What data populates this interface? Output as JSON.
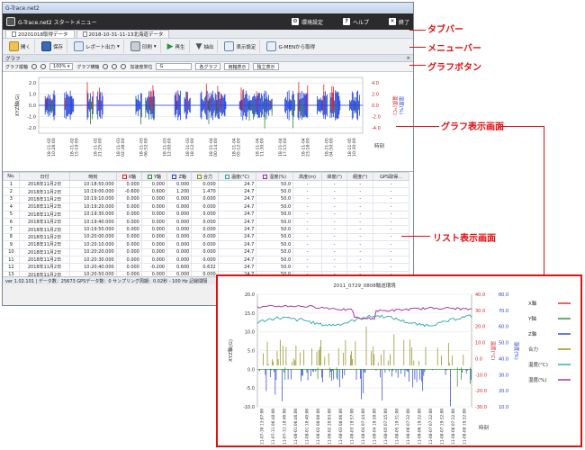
{
  "window": {
    "title": "G-Trace.net2"
  },
  "topbar": {
    "app_name": "G-Trace.net2 スタートメニュー",
    "env_label": "環境設定",
    "help_label": "ヘルプ",
    "exit_label": "終了"
  },
  "tabs": [
    {
      "label": "20201018取得データ"
    },
    {
      "label": "2018-10-31-11-13北海道データ"
    }
  ],
  "menu": [
    {
      "label": "開く"
    },
    {
      "label": "保存"
    },
    {
      "label": "レポート出力"
    },
    {
      "label": "印刷"
    },
    {
      "label": "再生"
    },
    {
      "label": "抽出"
    },
    {
      "label": "表示設定"
    },
    {
      "label": "G-MENから取得"
    }
  ],
  "graph_panel": {
    "title": "グラフ",
    "close": "×",
    "tools": {
      "zoom_label": "グラフ縦軸",
      "zoom_value": "100%",
      "hzoom_label": "グラフ横軸",
      "accel_label": "加速度単位",
      "accel_value": "G",
      "btn1": "各グラフ",
      "btn2": "両軸表示",
      "btn3": "独立表示"
    },
    "y_label": "XYZ軸(G)",
    "y2_label": "温度(°C)",
    "y3_label": "湿度(%)",
    "x_label": "時刻",
    "y_ticks": [
      "2.0",
      "1.0",
      "0.0",
      "-1.0",
      "-2.0"
    ],
    "y2_ticks": [
      "4.0",
      "2.0",
      "0.0",
      "-2.0",
      "-4.0"
    ],
    "x_ticks": [
      "18-11-02\n10:28:00",
      "18-11-02\n15:19:00",
      "18-11-02\n21:25:00",
      "18-11-03\n02:38:00",
      "18-11-03\n06:52:00",
      "18-11-03\n12:00:00",
      "18-11-03\n18:12:00",
      "18-11-04\n00:14:00",
      "18-11-04\n05:12:00",
      "18-11-04\n11:30:00",
      "18-11-04\n17:15:00",
      "18-11-04\n23:18:00",
      "18-11-05\n04:50:00",
      "18-11-05\n10:30:00"
    ]
  },
  "list_panel": {
    "headers": [
      "No.",
      "日付",
      "時刻",
      "X軸",
      "Y軸",
      "Z軸",
      "合力",
      "温度(°C)",
      "湿度(%)",
      "高度(m)",
      "緯度(°)",
      "経度(°)",
      "GPS取得..."
    ],
    "rows": [
      [
        "1",
        "2018年11月2日",
        "10:18:50.000",
        "0.000",
        "0.000",
        "0.000",
        "0.000",
        "24.7",
        "50.0",
        "-",
        "-",
        "-",
        "-"
      ],
      [
        "2",
        "2018年11月2日",
        "10:19:00.000",
        "-0.600",
        "0.600",
        "1.200",
        "1.470",
        "24.7",
        "50.0",
        "-",
        "-",
        "-",
        "-"
      ],
      [
        "3",
        "2018年11月2日",
        "10:19:10.000",
        "0.000",
        "0.000",
        "0.000",
        "0.000",
        "24.7",
        "50.0",
        "-",
        "-",
        "-",
        "-"
      ],
      [
        "4",
        "2018年11月2日",
        "10:19:20.000",
        "0.000",
        "0.000",
        "0.000",
        "0.000",
        "24.7",
        "50.0",
        "-",
        "-",
        "-",
        "-"
      ],
      [
        "5",
        "2018年11月2日",
        "10:19:30.000",
        "0.000",
        "0.000",
        "0.000",
        "0.000",
        "24.7",
        "50.0",
        "-",
        "-",
        "-",
        "-"
      ],
      [
        "6",
        "2018年11月2日",
        "10:19:40.000",
        "0.000",
        "0.000",
        "0.000",
        "0.000",
        "24.7",
        "50.0",
        "-",
        "-",
        "-",
        "-"
      ],
      [
        "7",
        "2018年11月2日",
        "10:19:50.000",
        "0.000",
        "0.000",
        "0.000",
        "0.000",
        "24.7",
        "50.0",
        "-",
        "-",
        "-",
        "-"
      ],
      [
        "8",
        "2018年11月2日",
        "10:20:00.000",
        "0.000",
        "0.000",
        "0.000",
        "0.000",
        "24.7",
        "50.0",
        "-",
        "-",
        "-",
        "-"
      ],
      [
        "9",
        "2018年11月2日",
        "10:20:10.000",
        "0.000",
        "0.000",
        "0.000",
        "0.000",
        "24.7",
        "50.0",
        "-",
        "-",
        "-",
        "-"
      ],
      [
        "10",
        "2018年11月2日",
        "10:20:20.000",
        "0.000",
        "0.000",
        "0.000",
        "0.000",
        "24.7",
        "50.0",
        "-",
        "-",
        "-",
        "-"
      ],
      [
        "11",
        "2018年11月2日",
        "10:20:30.000",
        "0.000",
        "0.000",
        "0.000",
        "0.000",
        "24.7",
        "50.0",
        "-",
        "-",
        "-",
        "-"
      ],
      [
        "12",
        "2018年11月2日",
        "10:20:40.000",
        "0.000",
        "-0.200",
        "0.600",
        "0.632",
        "24.7",
        "50.0",
        "-",
        "-",
        "-",
        "-"
      ],
      [
        "13",
        "2018年11月2日",
        "10:20:50.000",
        "0.000",
        "0.000",
        "0.000",
        "0.000",
        "24.7",
        "50.0",
        "-",
        "-",
        "-",
        "-"
      ]
    ]
  },
  "status": {
    "text": "ver 1.02.101 | データ数：25673  GPSデータ数：0  サンプリング周期：0.02秒 - 100 Hz  記録間隔"
  },
  "annotations": {
    "tab": "タブバー",
    "menu": "メニューバー",
    "graph_button": "グラフボタン",
    "graph_view": "グラフ表示画面",
    "list_view": "リスト表示画面"
  },
  "inset": {
    "title": "2011_0729_0808輸送環境",
    "y_label": "XYZ軸(G)",
    "y2_label": "温度(°C)",
    "y3_label": "湿度(%)",
    "x_label": "時刻",
    "y_ticks": [
      "20.0",
      "15.0",
      "10.0",
      "5.0",
      "0.0",
      "-5.0",
      "-10.0"
    ],
    "y2_ticks": [
      "40.0",
      "30.0",
      "20.0",
      "10.0",
      "0.0",
      "-10.0",
      "-20.0",
      "-30.0"
    ],
    "y3_ticks": [
      "80.0",
      "70.0",
      "60.0",
      "50.0",
      "40.0",
      "30.0",
      "20.0",
      "10.0"
    ],
    "legend": [
      "X軸",
      "Y軸",
      "Z軸",
      "合力",
      "温度(°C)",
      "湿度(%)"
    ],
    "x_ticks": [
      "11-07-30 13:07:00",
      "11-07-31 06:48:00",
      "11-07-31 18:46:00",
      "11-08-01 06:46:00",
      "11-08-01 18:40:00",
      "11-08-02 08:08:00",
      "11-08-02 20:03:00",
      "11-08-03 08:06:00",
      "11-08-03 19:57:00",
      "11-08-04 07:44:00",
      "11-08-04 19:38:00",
      "11-08-05 07:45:00",
      "11-08-05 19:31:00",
      "11-08-06 07:32:00",
      "11-08-06 19:32:00",
      "11-08-07 07:32:00",
      "11-08-07 19:32:00",
      "11-08-08 07:32:00",
      "11-08-08 19:32:00"
    ]
  },
  "colors": {
    "x_axis": "#e02020",
    "y_axis": "#2a8a2a",
    "z_axis": "#1f3fd8",
    "resultant": "#8a8a10",
    "temperature": "#2aa6a6",
    "humidity": "#a0289e",
    "accent": "#e01010"
  }
}
